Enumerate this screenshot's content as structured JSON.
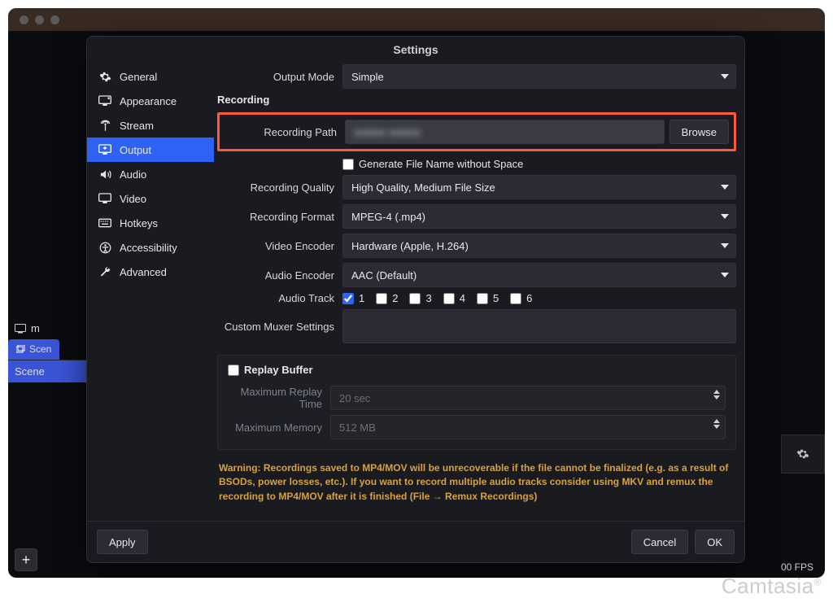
{
  "watermark": "Camtasia",
  "dialog_title": "Settings",
  "back": {
    "scenes_tab": "Scen",
    "scene_item": "Scene",
    "m_row": "m",
    "fps": "00 FPS"
  },
  "sidebar": {
    "items": [
      {
        "label": "General"
      },
      {
        "label": "Appearance"
      },
      {
        "label": "Stream"
      },
      {
        "label": "Output"
      },
      {
        "label": "Audio"
      },
      {
        "label": "Video"
      },
      {
        "label": "Hotkeys"
      },
      {
        "label": "Accessibility"
      },
      {
        "label": "Advanced"
      }
    ],
    "active_index": 3
  },
  "output": {
    "output_mode_label": "Output Mode",
    "output_mode_value": "Simple",
    "recording_header": "Recording",
    "recording_path_label": "Recording Path",
    "recording_path_value": "●●●●● ●●●●●",
    "browse_label": "Browse",
    "gen_filename_label": "Generate File Name without Space",
    "recording_quality_label": "Recording Quality",
    "recording_quality_value": "High Quality, Medium File Size",
    "recording_format_label": "Recording Format",
    "recording_format_value": "MPEG-4 (.mp4)",
    "video_encoder_label": "Video Encoder",
    "video_encoder_value": "Hardware (Apple, H.264)",
    "audio_encoder_label": "Audio Encoder",
    "audio_encoder_value": "AAC (Default)",
    "audio_track_label": "Audio Track",
    "tracks": [
      "1",
      "2",
      "3",
      "4",
      "5",
      "6"
    ],
    "tracks_checked": [
      true,
      false,
      false,
      false,
      false,
      false
    ],
    "custom_muxer_label": "Custom Muxer Settings"
  },
  "replay": {
    "header": "Replay Buffer",
    "max_time_label": "Maximum Replay Time",
    "max_time_value": "20 sec",
    "max_mem_label": "Maximum Memory",
    "max_mem_value": "512 MB"
  },
  "warning_text": "Warning: Recordings saved to MP4/MOV will be unrecoverable if the file cannot be finalized (e.g. as a result of BSODs, power losses, etc.). If you want to record multiple audio tracks consider using MKV and remux the recording to MP4/MOV after it is finished (File → Remux Recordings)",
  "footer": {
    "apply": "Apply",
    "cancel": "Cancel",
    "ok": "OK"
  }
}
